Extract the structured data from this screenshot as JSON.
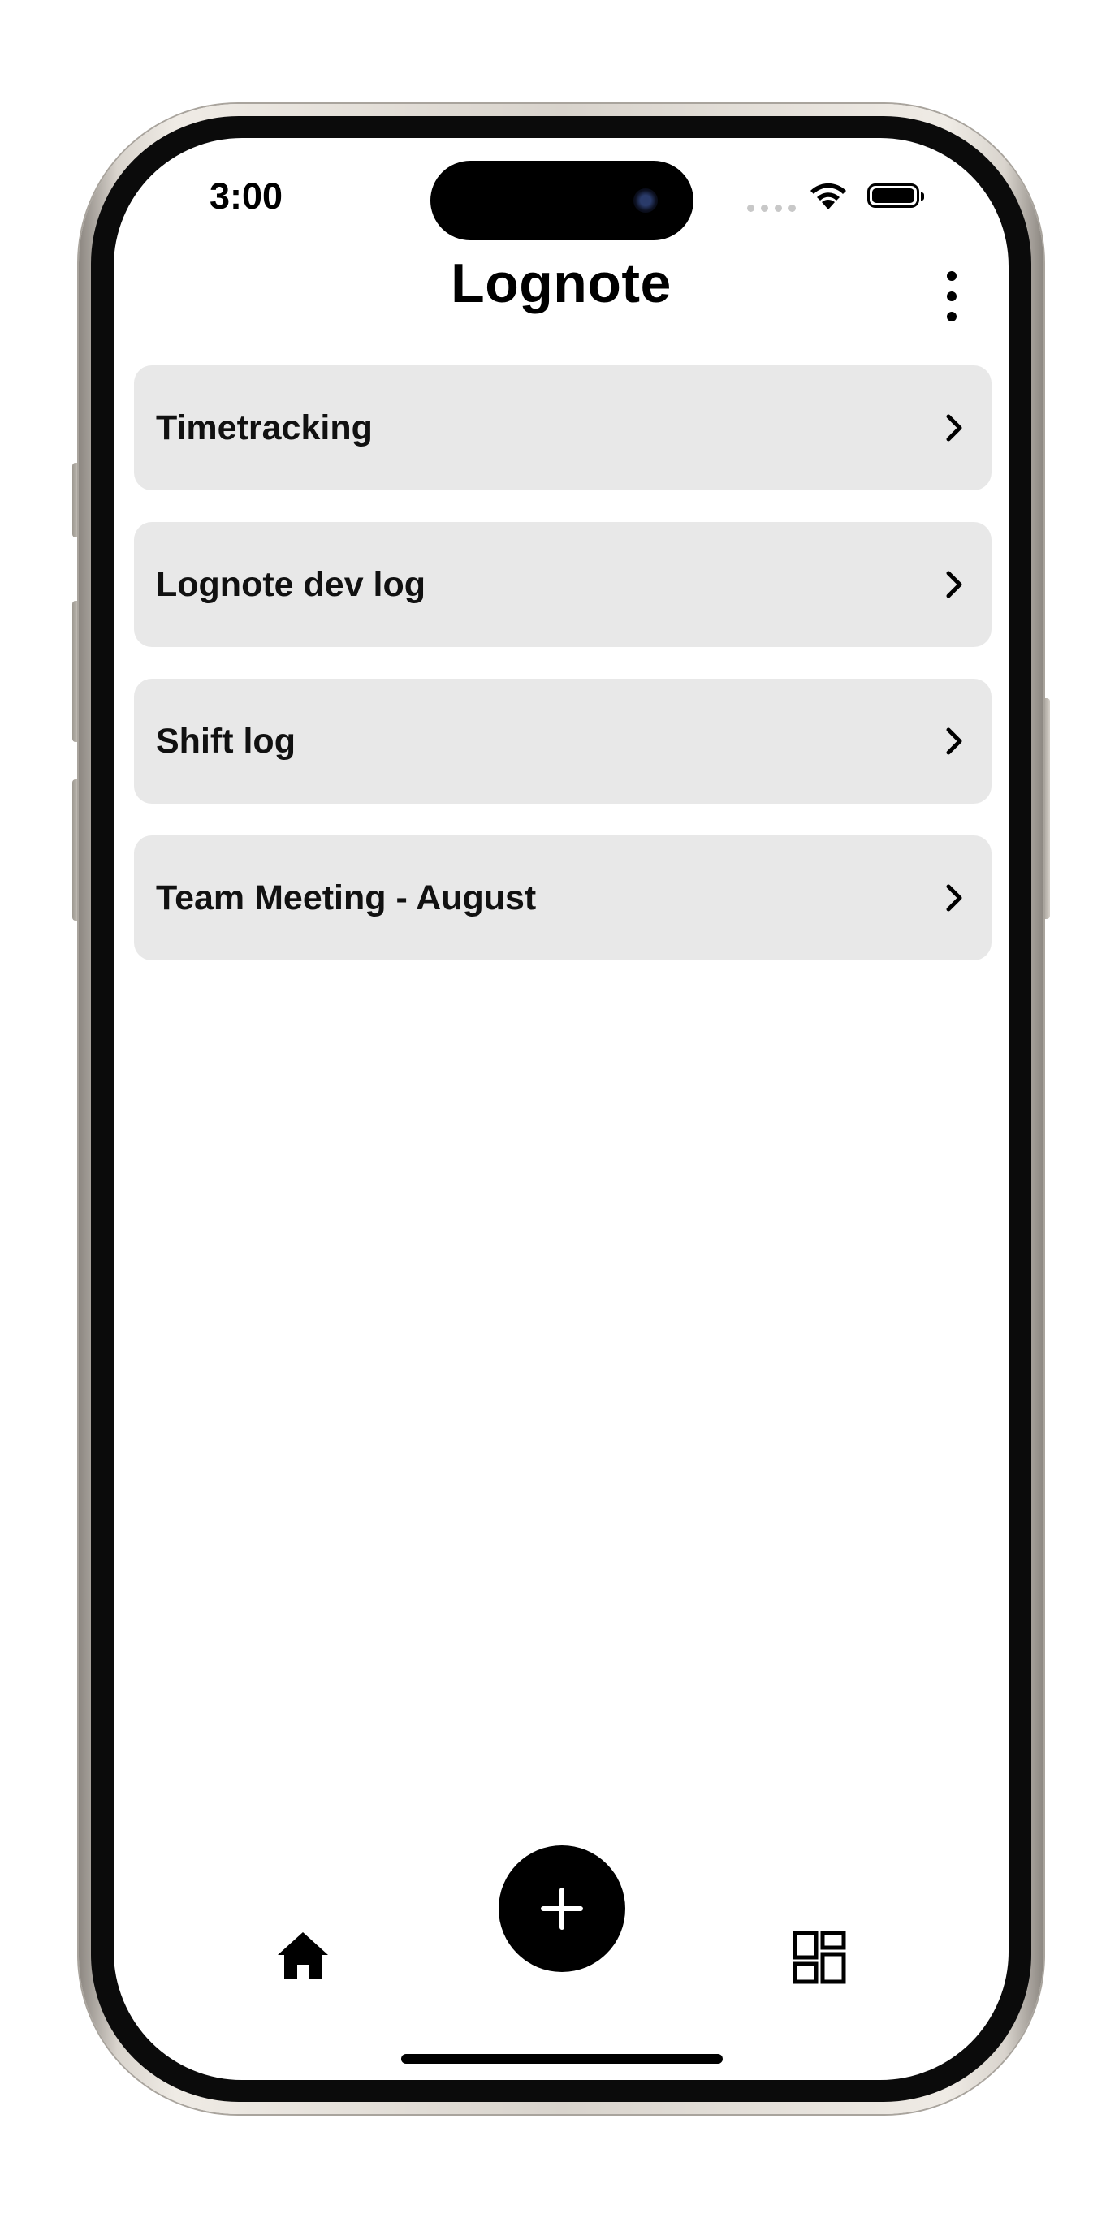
{
  "status_bar": {
    "time": "3:00"
  },
  "header": {
    "title": "Lognote",
    "menu_icon": "more-vertical-icon"
  },
  "logs": [
    {
      "label": "Timetracking"
    },
    {
      "label": "Lognote dev log"
    },
    {
      "label": "Shift log"
    },
    {
      "label": "Team Meeting - August"
    }
  ],
  "bottom_bar": {
    "home_icon": "home-icon",
    "add_icon": "plus-icon",
    "grid_icon": "dashboard-grid-icon"
  },
  "colors": {
    "list_item_bg": "#e8e8e8",
    "accent": "#000000"
  }
}
